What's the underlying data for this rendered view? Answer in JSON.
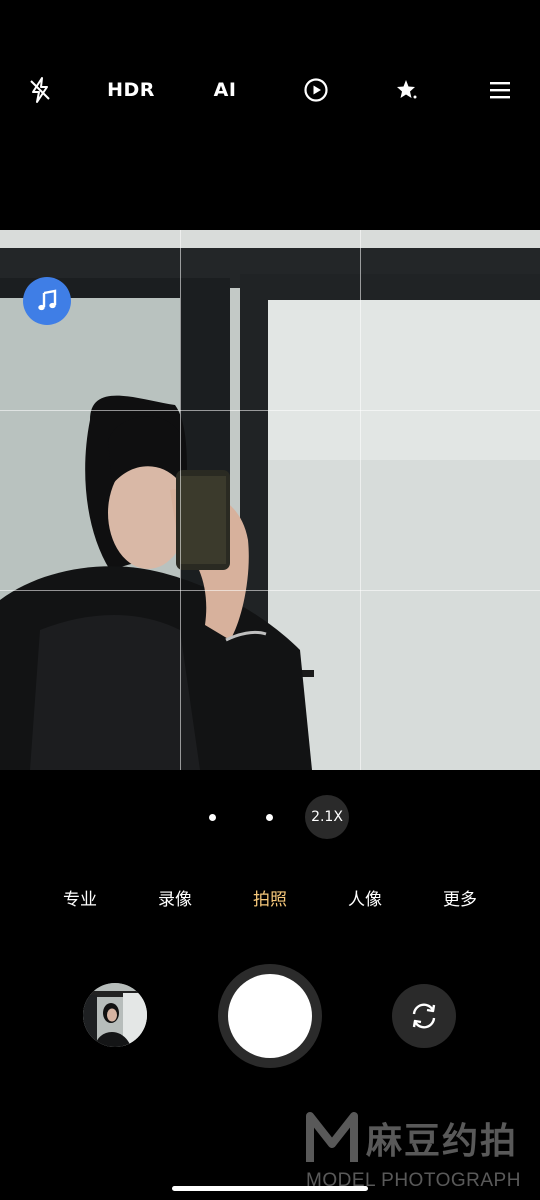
{
  "top_bar": {
    "flash_icon": "flash-off-icon",
    "hdr_label": "HDR",
    "ai_label": "AI",
    "live_icon": "live-photo-icon",
    "beauty_icon": "magic-star-icon",
    "menu_icon": "menu-icon"
  },
  "viewfinder": {
    "music_icon": "music-note-icon",
    "accent_color": "#3f7ee6"
  },
  "zoom": {
    "current": "2.1X"
  },
  "modes": [
    {
      "label": "专业"
    },
    {
      "label": "录像"
    },
    {
      "label": "拍照"
    },
    {
      "label": "人像"
    },
    {
      "label": "更多"
    }
  ],
  "active_mode": "拍照",
  "active_color": "#f5c77a",
  "controls": {
    "gallery_icon": "gallery-thumbnail",
    "shutter_icon": "shutter-button",
    "switch_icon": "camera-switch-icon"
  },
  "watermark": {
    "logo_letter": "M",
    "cn_text": "麻豆约拍",
    "en_text": "MODEL PHOTOGRAPH"
  }
}
